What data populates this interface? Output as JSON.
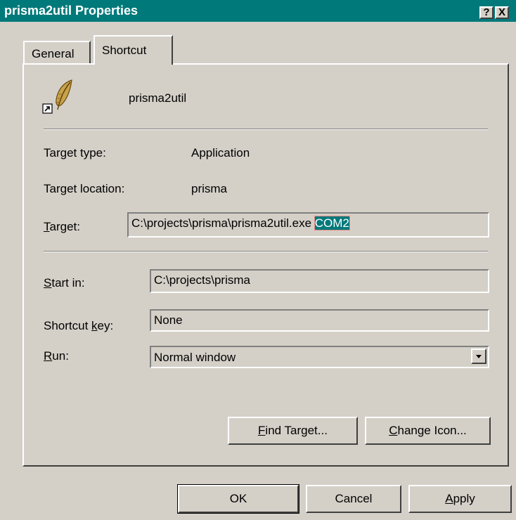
{
  "window": {
    "title": "prisma2util Properties",
    "help_glyph": "?",
    "close_glyph": "X"
  },
  "tabs": {
    "general": "General",
    "shortcut": "Shortcut"
  },
  "shortcut": {
    "name": "prisma2util",
    "icon": "feather-icon",
    "target_type_label": "Target type:",
    "target_type_value": "Application",
    "target_location_label": "Target location:",
    "target_location_value": "prisma",
    "target_label_first": "T",
    "target_label_rest": "arget:",
    "target_value_path": "C:\\projects\\prisma\\prisma2util.exe ",
    "target_value_selected": "COM2",
    "start_in_label_first": "S",
    "start_in_label_rest": "tart in:",
    "start_in_value": "C:\\projects\\prisma",
    "shortcut_key_label_pre": "Shortcut ",
    "shortcut_key_label_u": "k",
    "shortcut_key_label_post": "ey:",
    "shortcut_key_value": "None",
    "run_label_first": "R",
    "run_label_rest": "un:",
    "run_value": "Normal window",
    "find_target_first": "F",
    "find_target_rest": "ind Target...",
    "change_icon_first": "C",
    "change_icon_rest": "hange Icon..."
  },
  "footer": {
    "ok": "OK",
    "cancel": "Cancel",
    "apply_first": "A",
    "apply_rest": "pply"
  },
  "colors": {
    "titlebar": "#00797a",
    "face": "#d4d0c8",
    "selection": "#00797a"
  }
}
